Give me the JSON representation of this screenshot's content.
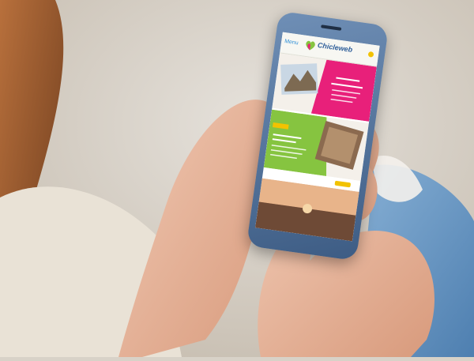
{
  "scene": {
    "description_colors": {
      "background": "#d8d2c8",
      "skin": "#e8b9a2",
      "jeans": "#6b97c3",
      "phone_frame": "#4b6b96"
    }
  },
  "phone": {
    "app": {
      "menu_label": "Menu",
      "logo_text": "Chicleweb",
      "accent_colors": {
        "pink": "#e8207a",
        "green": "#86c440",
        "yellow": "#f2c200",
        "blue": "#2f8fd6"
      }
    }
  }
}
